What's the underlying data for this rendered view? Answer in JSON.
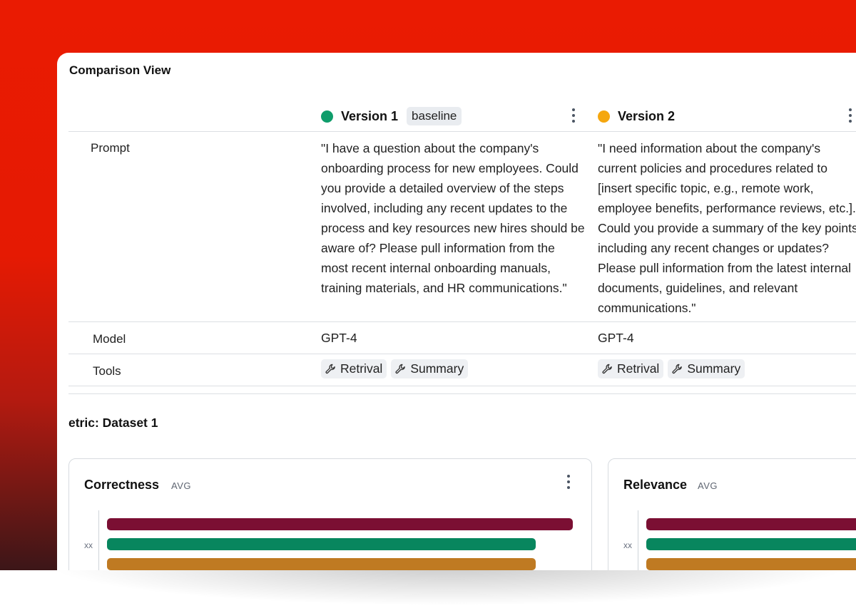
{
  "window": {
    "title": "Comparison View"
  },
  "versions": [
    {
      "name": "Version 1",
      "badge": "baseline",
      "color": "#0f9d6b",
      "prompt": "\"I have a question about the company's onboarding process for new employees. Could you provide a detailed overview of the steps involved, including any recent updates to the process and key resources new hires should be aware of? Please pull information from the most recent internal onboarding manuals, training materials, and HR communications.\"",
      "model": "GPT-4",
      "tools": [
        "Retrival",
        "Summary"
      ]
    },
    {
      "name": "Version 2",
      "badge": "",
      "color": "#f5a70f",
      "prompt": "\"I need information about the company's current policies and procedures related to [insert specific topic, e.g., remote work, employee benefits, performance reviews, etc.]. Could you provide a summary of the key points, including any recent changes or updates? Please pull information from the latest internal documents, guidelines, and relevant communications.\"",
      "model": "GPT-4",
      "tools": [
        "Retrival",
        "Summary"
      ]
    }
  ],
  "rows": {
    "prompt": "Prompt",
    "model": "Model",
    "tools": "Tools"
  },
  "metrics": {
    "section_title": "etric: Dataset 1",
    "cards": [
      {
        "title": "Correctness",
        "agg": "AVG",
        "category": "xx"
      },
      {
        "title": "Relevance",
        "agg": "AVG",
        "category": "xx"
      }
    ]
  },
  "chart_data": [
    {
      "type": "bar",
      "title": "Correctness",
      "categories": [
        "xx"
      ],
      "series": [
        {
          "values": [
            1.0
          ],
          "color": "#7b0f33"
        },
        {
          "values": [
            0.92
          ],
          "color": "#08865e"
        },
        {
          "values": [
            0.92
          ],
          "color": "#bf7a22"
        }
      ]
    },
    {
      "type": "bar",
      "title": "Relevance",
      "categories": [
        "xx"
      ],
      "series": [
        {
          "values": [
            1.0
          ],
          "color": "#7b0f33"
        },
        {
          "values": [
            1.0
          ],
          "color": "#08865e"
        },
        {
          "values": [
            1.0
          ],
          "color": "#bf7a22"
        }
      ]
    }
  ]
}
